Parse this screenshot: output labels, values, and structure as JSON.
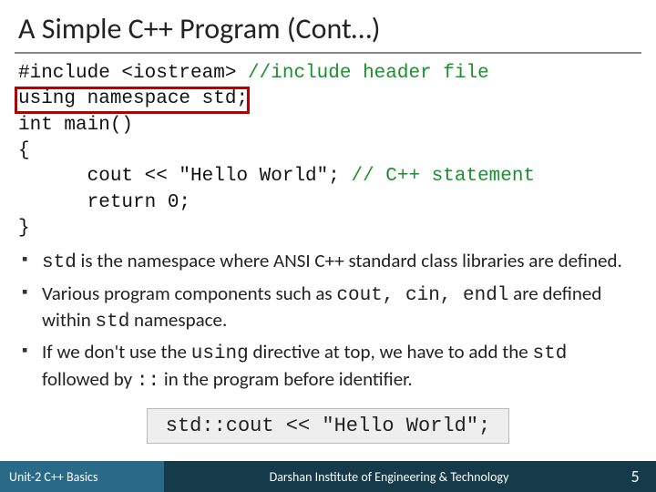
{
  "title": "A Simple C++ Program (Cont…)",
  "code": {
    "l1a": "#include <iostream>",
    "l1b": " //include header file",
    "l2": "using namespace std;",
    "l3": "int main()",
    "l4": "{",
    "l5a": "      cout << \"Hello World\";",
    "l5b": " // C++ statement",
    "l6": "      return 0;",
    "l7": "}"
  },
  "bullets": {
    "b1a": "std",
    "b1b": " is the namespace where ANSI C++ standard class libraries are defined.",
    "b2a": "Various program components such as ",
    "b2b": "cout, cin, endl",
    "b2c": " are defined within ",
    "b2d": "std",
    "b2e": " namespace.",
    "b3a": "If we don't use the ",
    "b3b": "using",
    "b3c": " directive at top, we have to add the ",
    "b3d": "std",
    "b3e": " followed by ",
    "b3f": "::",
    "b3g": " in the program before identifier."
  },
  "example": "std::cout << \"Hello World\";",
  "footer": {
    "left": "Unit-2 C++ Basics",
    "mid": "Darshan Institute of Engineering & Technology",
    "page": "5"
  }
}
